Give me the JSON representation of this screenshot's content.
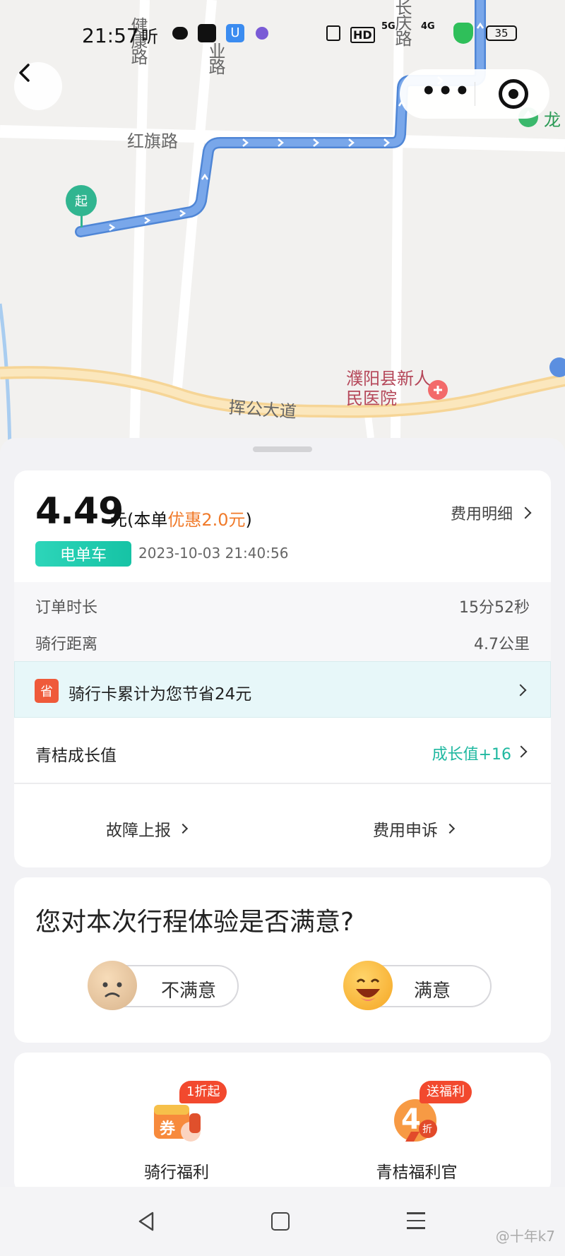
{
  "status_bar": {
    "time": "21:57",
    "icons_left": [
      "hearing-icon",
      "wechat-icon",
      "tiktok-icon",
      "u-app-icon",
      "app-icon"
    ],
    "icons_right": [
      "nfc-icon",
      "hd-icon",
      "5g-signal-icon",
      "4g-signal-icon",
      "shield-icon",
      "battery-icon"
    ],
    "hearing_glyph": "听",
    "hd_text": "HD",
    "signal_5g": "5G",
    "signal_4g": "4G",
    "battery": "35"
  },
  "map": {
    "roads": {
      "jiankang": "健康路",
      "hongqi": "红旗路",
      "ye": "业路",
      "changqing": "长庆路",
      "huigong": "挥公大道"
    },
    "poi": {
      "hospital": "濮阳县新人民医院",
      "long": "龙"
    },
    "start_marker": "起",
    "route_color": "#6c9de8"
  },
  "order": {
    "price": "4.49",
    "price_unit": "元(本单",
    "discount": "优惠2.0元",
    "close_paren": ")",
    "fee_detail": "费用明细",
    "vehicle_type": "电单车",
    "datetime": "2023-10-03 21:40:56",
    "duration_label": "订单时长",
    "duration_value": "15分52秒",
    "distance_label": "骑行距离",
    "distance_value": "4.7公里",
    "save_badge": "省",
    "save_text": "骑行卡累计为您节省24元",
    "growth_label": "青桔成长值",
    "growth_value": "成长值+16",
    "report_fault": "故障上报",
    "fee_appeal": "费用申诉"
  },
  "survey": {
    "question": "您对本次行程体验是否满意?",
    "unsatisfied": "不满意",
    "satisfied": "满意"
  },
  "welfare": {
    "items": [
      {
        "label": "骑行福利",
        "badge": "1折起",
        "icon_text": "券"
      },
      {
        "label": "青桔福利官",
        "badge": "送福利",
        "icon_text": "4"
      }
    ],
    "discount_small": "折"
  },
  "watermark": "@十年k7",
  "colors": {
    "accent_teal": "#1fb8a0",
    "discount_orange": "#f07a2a",
    "badge_red": "#f2492e"
  }
}
